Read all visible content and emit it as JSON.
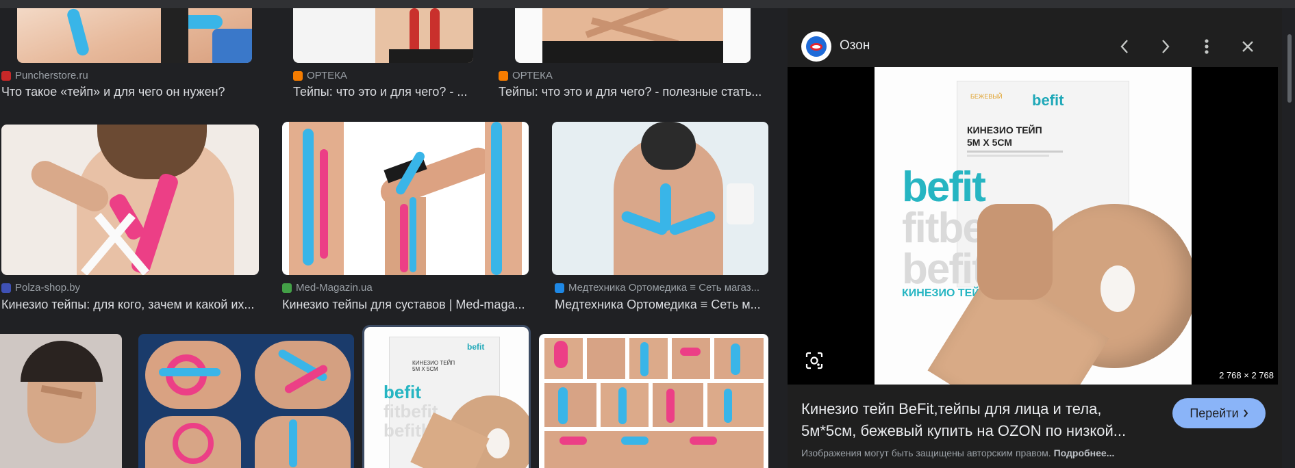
{
  "results": [
    {
      "source": "Puncherstore.ru",
      "title": "Что такое «тейп» и для чего он нужен?",
      "favicon_color": "#c62828"
    },
    {
      "source": "ОРТЕКА",
      "title": "Тейпы: что это и для чего? - ...",
      "favicon_color": "#f57c00"
    },
    {
      "source": "ОРТЕКА",
      "title": "Тейпы: что это и для чего? - полезные стать...",
      "favicon_color": "#f57c00"
    },
    {
      "source": "Polza-shop.by",
      "title": "Кинезио тейпы: для кого, зачем и какой их...",
      "favicon_color": "#3f51b5"
    },
    {
      "source": "Med-Magazin.ua",
      "title": "Кинезио тейпы для суставов | Med-maga...",
      "favicon_color": "#43a047"
    },
    {
      "source": "Медтехника Ортомедика ≡ Сеть магаз...",
      "title": "Медтехника Ортомедика ≡ Сеть м...",
      "favicon_color": "#1e88e5"
    }
  ],
  "panel": {
    "site": "Озон",
    "dimensions": "2 768 × 2 768",
    "title_line1": "Кинезио тейп BeFit,тейпы для лица и тела,",
    "title_line2": "5м*5см, бежевый купить на OZON по низкой...",
    "go_label": "Перейти",
    "copyright": "Изображения могут быть защищены авторским правом.",
    "more_label": "Подробнее...",
    "product": {
      "brand": "befit",
      "line1": "КИНЕЗИО ТЕЙП",
      "line2": "5М Х 5СМ",
      "box_label": "КИНЕЗИО ТЕЙП",
      "color_label": "БЕЖЕВЫЙ"
    }
  },
  "colors": {
    "accent": "#8ab4f8",
    "background": "#202124",
    "panel": "#1f1f1f"
  },
  "icons": [
    "prev-icon",
    "next-icon",
    "more-vert-icon",
    "close-icon",
    "lens-icon"
  ]
}
